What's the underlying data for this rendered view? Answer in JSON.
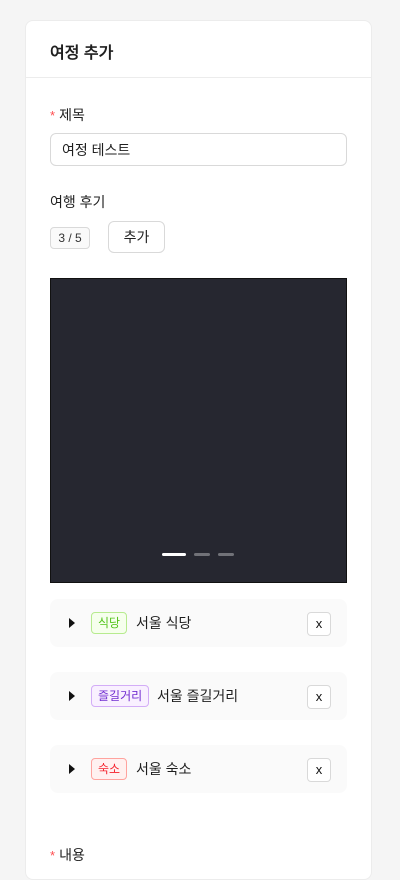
{
  "header": {
    "title": "여정 추가"
  },
  "title_field": {
    "required_mark": "*",
    "label": "제목",
    "value": "여정 테스트"
  },
  "review": {
    "label": "여행 후기",
    "count": "3 / 5",
    "add_label": "추가"
  },
  "carousel": {
    "slide_count": 3,
    "active_index": 0
  },
  "places": [
    {
      "category": "식당",
      "name": "서울 식당",
      "tag_color": "#52c41a",
      "remove_label": "x"
    },
    {
      "category": "즐길거리",
      "name": "서울 즐길거리",
      "tag_color": "#722ed1",
      "remove_label": "x"
    },
    {
      "category": "숙소",
      "name": "서울 숙소",
      "tag_color": "#f5222d",
      "remove_label": "x"
    }
  ],
  "content_field": {
    "required_mark": "*",
    "label": "내용"
  }
}
